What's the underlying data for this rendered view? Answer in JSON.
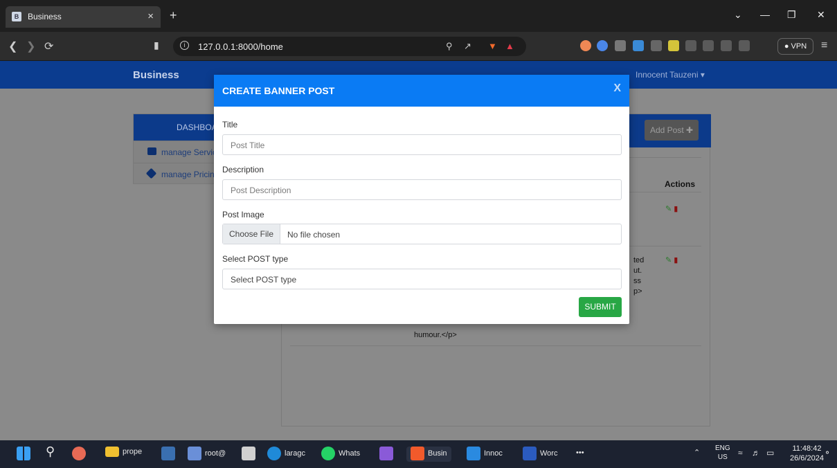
{
  "browser": {
    "tab_title": "Business",
    "tab_close": "×",
    "new_tab": "+",
    "url": "127.0.0.1:8000/home",
    "vpn": "● VPN",
    "window_controls": [
      "⌄",
      "—",
      "❐",
      "✕"
    ]
  },
  "navbar": {
    "brand": "Business",
    "user": "Innocent Tauzeni ▾"
  },
  "sidebar": {
    "header": "DASHBOA",
    "items": [
      {
        "label": "manage Servic",
        "icon": "briefcase-icon"
      },
      {
        "label": "manage Pricin",
        "icon": "tag-icon"
      }
    ]
  },
  "card": {
    "add_post": "Add Post ✚",
    "actions_header": "Actions",
    "tail_lines_right": [
      "ted",
      "ut.",
      "ss",
      "p>",
      ""
    ],
    "tail_line_bottom": "humour.</p>"
  },
  "modal": {
    "title": "CREATE BANNER POST",
    "close": "X",
    "fields": {
      "title_label": "Title",
      "title_placeholder": "Post Title",
      "description_label": "Description",
      "description_placeholder": "Post Description",
      "image_label": "Post Image",
      "choose_file": "Choose File",
      "no_file": "No file chosen",
      "type_label": "Select POST type",
      "type_placeholder": "Select POST type"
    },
    "submit": "SUBMIT"
  },
  "taskbar": {
    "items": [
      {
        "label": "prope",
        "icon": "folder-icon"
      },
      {
        "label": "root@",
        "icon": "network-icon"
      },
      {
        "label": "laragc",
        "icon": "laragon-icon"
      },
      {
        "label": "Whats",
        "icon": "whatsapp-icon"
      },
      {
        "label": "Busin",
        "icon": "brave-icon"
      },
      {
        "label": "Innoc",
        "icon": "vscode-icon"
      },
      {
        "label": "Worc",
        "icon": "word-icon"
      }
    ],
    "more": "•••",
    "lang_line1": "ENG",
    "lang_line2": "US",
    "time": "11:48:42",
    "date": "26/6/2024",
    "badge_count": "1"
  }
}
